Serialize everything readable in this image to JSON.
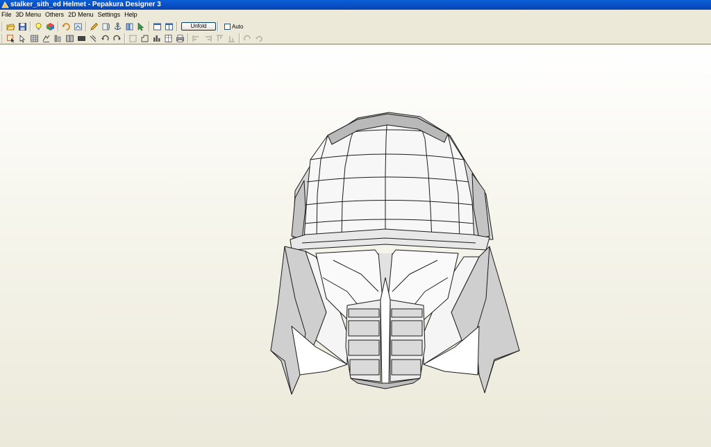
{
  "window": {
    "title": "stalker_sith_ed Helmet - Pepakura Designer 3"
  },
  "menu": [
    "File",
    "3D Menu",
    "Others",
    "2D Menu",
    "Settings",
    "Help"
  ],
  "toolbar1": {
    "buttons": [
      "open-icon",
      "save-icon",
      "lightbulb-icon",
      "texture-cube-icon",
      "undo-flip-icon",
      "print-view-icon",
      "pencil-icon",
      "paper-roll-icon",
      "anchor-icon",
      "mirror-icon",
      "select-arrow-icon",
      "window-single-icon",
      "window-split-icon"
    ],
    "unfold_label": "Unfold",
    "auto_label": "Auto",
    "auto_checked": false
  },
  "toolbar2": {
    "buttons": [
      "select-part-icon",
      "pointer-icon",
      "grid-icon",
      "align-icon",
      "edge-join-icon",
      "flaps-icon",
      "rect-icon",
      "join-icon",
      "rotate-left-icon",
      "rotate-right-icon",
      "move-icon",
      "scale-icon",
      "arrange-icon",
      "page-icon",
      "print-icon",
      "align-left-icon",
      "align-right-icon",
      "align-top-icon",
      "align-bottom-icon",
      "redo-icon",
      "refresh-icon"
    ]
  },
  "colors": {
    "titlebar": "#0a5fd6",
    "chrome": "#ece9d8",
    "model_stroke": "#1a1a1a"
  }
}
